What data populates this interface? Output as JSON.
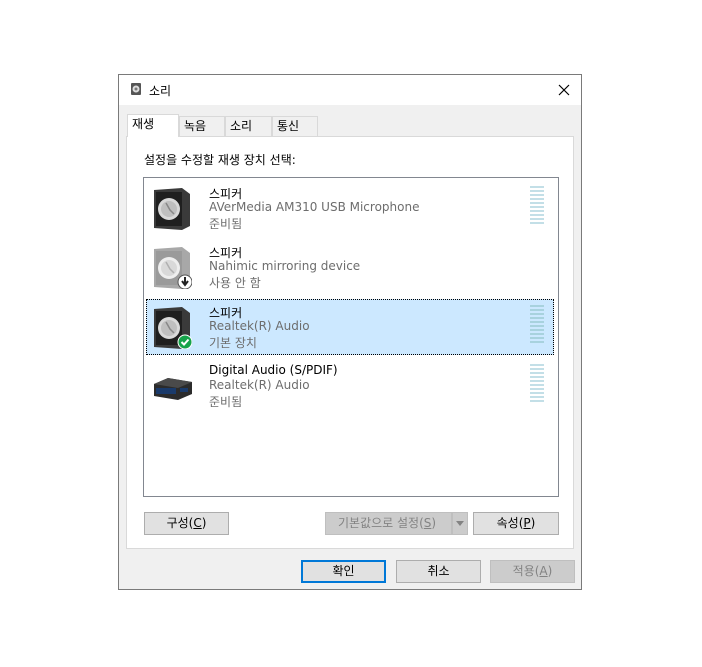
{
  "window": {
    "title": "소리",
    "close_icon": "close-icon"
  },
  "tabs": [
    {
      "label": "재생",
      "active": true
    },
    {
      "label": "녹음",
      "active": false
    },
    {
      "label": "소리",
      "active": false
    },
    {
      "label": "통신",
      "active": false
    }
  ],
  "instruction": "설정을 수정할 재생 장치 선택:",
  "devices": [
    {
      "name": "스피커",
      "description": "AVerMedia AM310 USB Microphone",
      "status": "준비됨",
      "icon": "speaker-icon",
      "badge": "",
      "selected": false
    },
    {
      "name": "스피커",
      "description": "Nahimic mirroring device",
      "status": "사용 안 함",
      "icon": "speaker-disabled-icon",
      "badge": "disabled-arrow-badge",
      "selected": false
    },
    {
      "name": "스피커",
      "description": "Realtek(R) Audio",
      "status": "기본 장치",
      "icon": "speaker-icon",
      "badge": "default-check-badge",
      "selected": true
    },
    {
      "name": "Digital Audio (S/PDIF)",
      "description": "Realtek(R) Audio",
      "status": "준비됨",
      "icon": "digital-audio-icon",
      "badge": "",
      "selected": false
    }
  ],
  "buttons": {
    "configure": {
      "label": "구성(",
      "mnemonic": "C",
      "suffix": ")"
    },
    "set_default": {
      "label": "기본값으로 설정(",
      "mnemonic": "S",
      "suffix": ")"
    },
    "properties": {
      "label": "속성(",
      "mnemonic": "P",
      "suffix": ")"
    },
    "ok": {
      "label": "확인"
    },
    "cancel": {
      "label": "취소"
    },
    "apply": {
      "label": "적용(",
      "mnemonic": "A",
      "suffix": ")"
    }
  },
  "colors": {
    "selection": "#cce8ff",
    "accent": "#0078d7",
    "check": "#16a34a"
  }
}
